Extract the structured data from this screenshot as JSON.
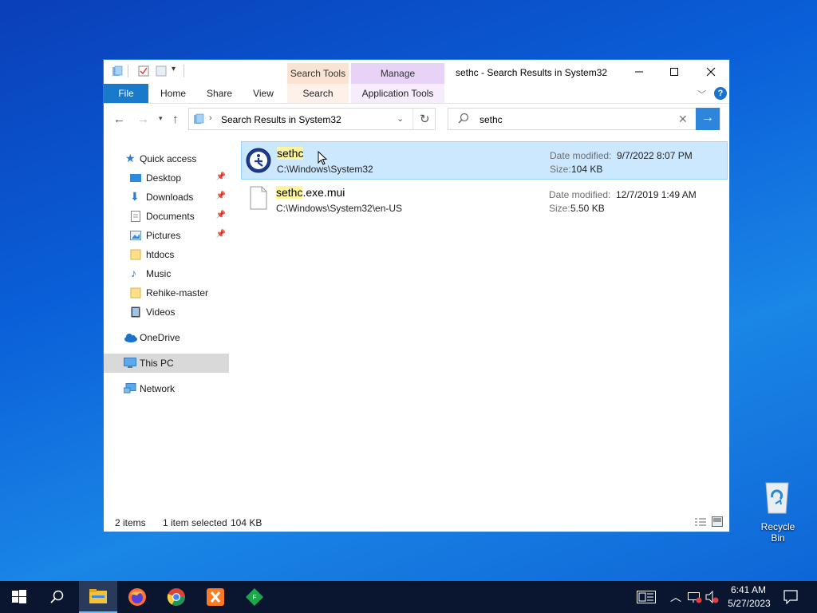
{
  "window": {
    "title": "sethc - Search Results in System32",
    "context_tabs": {
      "search_tools": "Search Tools",
      "manage": "Manage"
    },
    "ribbon_tabs": [
      "File",
      "Home",
      "Share",
      "View",
      "Search",
      "Application Tools"
    ],
    "address": "Search Results in System32",
    "search_value": "sethc"
  },
  "sidebar": {
    "quick_access": "Quick access",
    "items": [
      "Desktop",
      "Downloads",
      "Documents",
      "Pictures",
      "htdocs",
      "Music",
      "Rehike-master",
      "Videos"
    ],
    "onedrive": "OneDrive",
    "this_pc": "This PC",
    "network": "Network"
  },
  "results": [
    {
      "name_match": "sethc",
      "name_rest": "",
      "path": "C:\\Windows\\System32",
      "date_label": "Date modified:",
      "date": "9/7/2022 8:07 PM",
      "size_label": "Size:",
      "size": "104 KB"
    },
    {
      "name_match": "sethc",
      "name_rest": ".exe.mui",
      "path": "C:\\Windows\\System32\\en-US",
      "date_label": "Date modified:",
      "date": "12/7/2019 1:49 AM",
      "size_label": "Size:",
      "size": "5.50 KB"
    }
  ],
  "status": {
    "count": "2 items",
    "selection": "1 item selected",
    "size": "104 KB"
  },
  "desktop": {
    "recycle_bin": "Recycle Bin"
  },
  "taskbar": {
    "time": "6:41 AM",
    "date": "5/27/2023"
  },
  "colors": {
    "selection_bg": "#cce8ff",
    "accent": "#1979ca",
    "highlight": "#fff59d"
  }
}
